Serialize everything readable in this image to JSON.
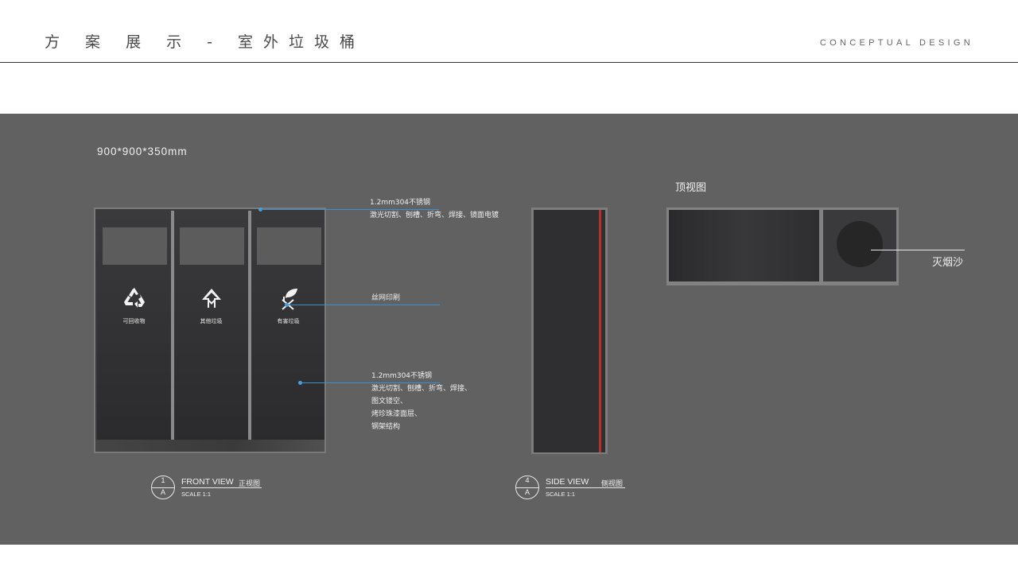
{
  "header": {
    "title": "方 案 展 示 - 室外垃圾桶",
    "subtitle": "CONCEPTUAL DESIGN"
  },
  "dimensions": "900*900*350mm",
  "front_view": {
    "bins": [
      {
        "label": "可回收物",
        "icon": "recycle-icon"
      },
      {
        "label": "其他垃圾",
        "icon": "other-waste-icon"
      },
      {
        "label": "有害垃圾",
        "icon": "hazardous-waste-icon"
      }
    ],
    "badge": {
      "top": "1",
      "bottom": "A",
      "name": "FRONT VIEW",
      "name_cn": "正视图",
      "scale": "SCALE 1:1"
    }
  },
  "side_view": {
    "badge": {
      "top": "4",
      "bottom": "A",
      "name": "SIDE VIEW",
      "name_cn": "侧视图",
      "scale": "SCALE 1:1"
    }
  },
  "top_view": {
    "label": "顶视图",
    "callout": "灭烟沙"
  },
  "annotations": [
    {
      "lines": [
        "1.2mm304不锈钢",
        "激光切割、刨槽、折弯、焊接、镜面电镀"
      ]
    },
    {
      "lines": [
        "丝网印刷"
      ]
    },
    {
      "lines": [
        "1.2mm304不锈钢",
        "激光切割、刨槽、折弯、焊接、",
        "图文镂空、",
        "烤珍珠漆面层、",
        "钢架结构"
      ]
    }
  ],
  "colors": {
    "panel": "#616161",
    "bin_body": "#3a3a3c",
    "leader": "#3a8fd0",
    "side_accent": "#b8302a"
  }
}
